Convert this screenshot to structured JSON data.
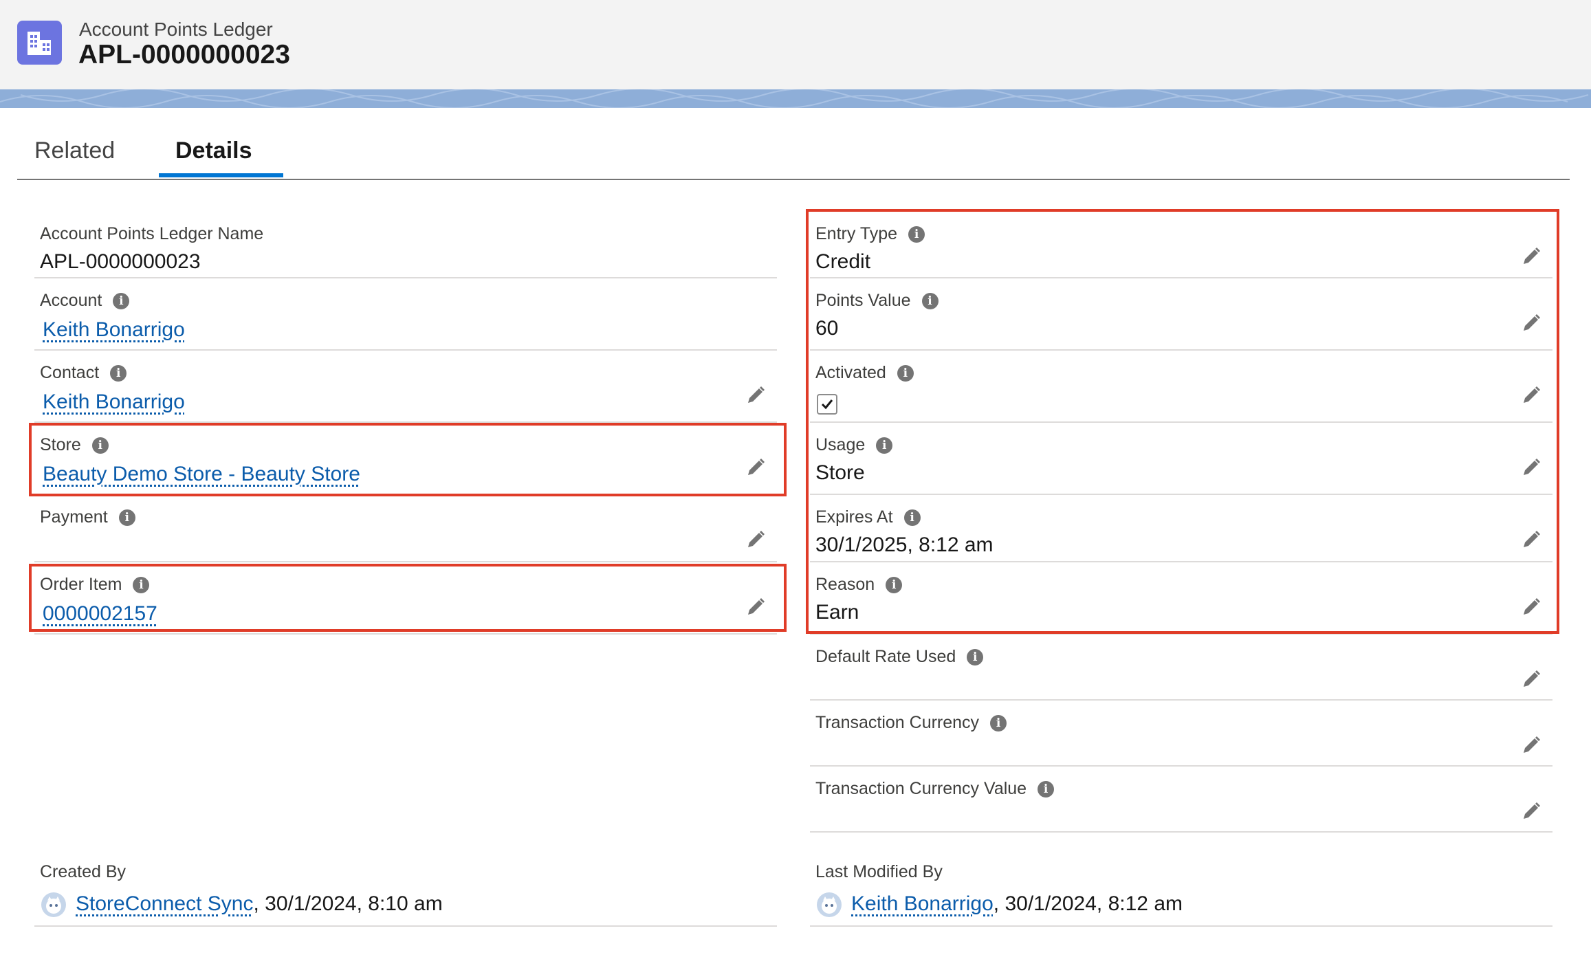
{
  "header": {
    "object_type": "Account Points Ledger",
    "record_name": "APL-0000000023",
    "icon": "building-icon"
  },
  "tabs": [
    {
      "label": "Related",
      "active": false
    },
    {
      "label": "Details",
      "active": true
    }
  ],
  "left_fields": {
    "name": {
      "label": "Account Points Ledger Name",
      "value": "APL-0000000023"
    },
    "account": {
      "label": "Account",
      "value": "Keith Bonarrigo"
    },
    "contact": {
      "label": "Contact",
      "value": "Keith Bonarrigo"
    },
    "store": {
      "label": "Store",
      "value": "Beauty Demo Store - Beauty Store"
    },
    "payment": {
      "label": "Payment",
      "value": ""
    },
    "order_item": {
      "label": "Order Item",
      "value": "0000002157"
    }
  },
  "right_fields": {
    "entry_type": {
      "label": "Entry Type",
      "value": "Credit"
    },
    "points_value": {
      "label": "Points Value",
      "value": "60"
    },
    "activated": {
      "label": "Activated",
      "checked": true
    },
    "usage": {
      "label": "Usage",
      "value": "Store"
    },
    "expires_at": {
      "label": "Expires At",
      "value": "30/1/2025, 8:12 am"
    },
    "reason": {
      "label": "Reason",
      "value": "Earn"
    },
    "default_rate_used": {
      "label": "Default Rate Used",
      "value": ""
    },
    "transaction_currency": {
      "label": "Transaction Currency",
      "value": ""
    },
    "transaction_currency_value": {
      "label": "Transaction Currency Value",
      "value": ""
    }
  },
  "system": {
    "created_by": {
      "label": "Created By",
      "user": "StoreConnect Sync",
      "timestamp": ", 30/1/2024, 8:10 am"
    },
    "last_modified_by": {
      "label": "Last Modified By",
      "user": "Keith Bonarrigo",
      "timestamp": ", 30/1/2024, 8:12 am"
    }
  },
  "colors": {
    "highlight": "#e03c28",
    "link": "#0b5cab",
    "icon_bg": "#6c74e0",
    "tab_active": "#0176d3"
  }
}
